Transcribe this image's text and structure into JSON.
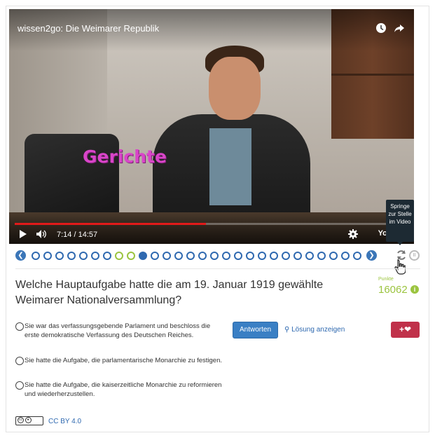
{
  "video": {
    "title": "wissen2go: Die Weimarer Republik",
    "overlay_text": "Gerichte",
    "time": "7:14 / 14:57",
    "progress_fraction": 0.485,
    "brand": "YouTube",
    "icons": [
      "clock-icon",
      "share-icon",
      "play-icon",
      "volume-icon",
      "settings-icon"
    ]
  },
  "tooltip": {
    "text": "Springe zur Stelle im Video"
  },
  "timeline": {
    "total": 28,
    "done_indices": [
      7,
      8
    ],
    "current_index": 9,
    "colors": {
      "accent": "#2f69b0",
      "done": "#9bc43f"
    }
  },
  "question": {
    "text": "Welche Hauptaufgabe hatte die am 19. Januar 1919 gewählte Weimarer Nationalversammlung?",
    "punkte_label": "Punkte",
    "punkte_value": "16062"
  },
  "answers": [
    "Sie war das verfassungsgebende Parlament und beschloss die erste demokratische Verfassung des Deutschen Reiches.",
    "Sie hatte die Aufgabe, die parlamentarische Monarchie zu festigen.",
    "Sie hatte die Aufgabe, die kaiserzeitliche Monarchie zu reformieren und wiederherzustellen."
  ],
  "actions": {
    "answer_button": "Antworten",
    "show_solution": "Lösung anzeigen",
    "favorite_label": "+"
  },
  "license": {
    "badge": "cc",
    "text": "CC BY 4.0"
  }
}
